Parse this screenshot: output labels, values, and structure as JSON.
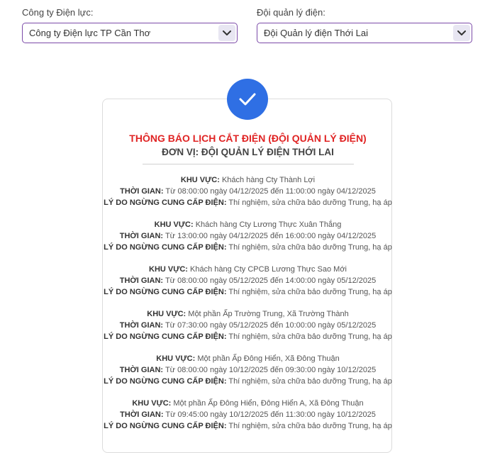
{
  "filters": {
    "company": {
      "label": "Công ty Điện lực:",
      "value": "Công ty Điện lực TP Cần Thơ"
    },
    "team": {
      "label": "Đội quản lý điện:",
      "value": "Đội Quản lý điện Thới Lai"
    }
  },
  "card": {
    "title": "THÔNG BÁO LỊCH CẮT ĐIỆN (ĐỘI QUẢN LÝ ĐIỆN)",
    "subtitle": "ĐƠN VỊ: ĐỘI QUẢN LÝ ĐIỆN THỚI LAI",
    "area_label": "KHU VỰC:",
    "time_label": "THỜI GIAN:",
    "reason_label": "LÝ DO NGỪNG CUNG CẤP ĐIỆN:",
    "notices": [
      {
        "area": "Khách hàng Cty Thành Lợi",
        "time": "Từ 08:00:00 ngày 04/12/2025 đến 11:00:00 ngày 04/12/2025",
        "reason": "Thí nghiệm, sửa chữa bảo dưỡng Trung, hạ áp"
      },
      {
        "area": "Khách hàng Cty Lương Thực Xuân Thắng",
        "time": "Từ 13:00:00 ngày 04/12/2025 đến 16:00:00 ngày 04/12/2025",
        "reason": "Thí nghiệm, sửa chữa bảo dưỡng Trung, hạ áp"
      },
      {
        "area": "Khách hàng Cty CPCB Lương Thực Sao Mới",
        "time": "Từ 08:00:00 ngày 05/12/2025 đến 14:00:00 ngày 05/12/2025",
        "reason": "Thí nghiệm, sửa chữa bảo dưỡng Trung, hạ áp"
      },
      {
        "area": "Một phần Ấp Trường Trung, Xã Trường Thành",
        "time": "Từ 07:30:00 ngày 05/12/2025 đến 10:00:00 ngày 05/12/2025",
        "reason": "Thí nghiệm, sửa chữa bảo dưỡng Trung, hạ áp"
      },
      {
        "area": "Một phần Ấp Đông Hiển, Xã Đông Thuận",
        "time": "Từ 08:00:00 ngày 10/12/2025 đến 09:30:00 ngày 10/12/2025",
        "reason": "Thí nghiệm, sửa chữa bảo dưỡng Trung, hạ áp"
      },
      {
        "area": "Một phần Ấp Đông Hiển, Đông Hiển A, Xã Đông Thuận",
        "time": "Từ 09:45:00 ngày 10/12/2025 đến 11:30:00 ngày 10/12/2025",
        "reason": "Thí nghiệm, sửa chữa bảo dưỡng Trung, hạ áp"
      }
    ]
  },
  "icons": {
    "success": "check-icon",
    "dropdown": "chevron-down-icon"
  },
  "colors": {
    "accent": "#7b4aa8",
    "title_red": "#e02424",
    "check_blue": "#2f6fe4"
  }
}
